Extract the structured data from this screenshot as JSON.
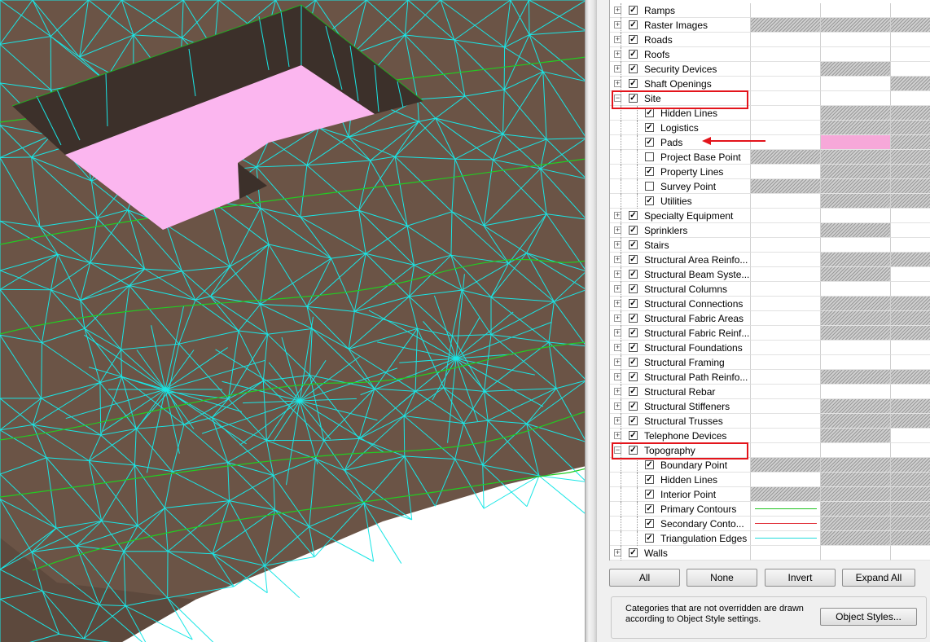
{
  "viewport": {
    "description_icons": [
      "terrain-mesh"
    ],
    "colors": {
      "terrain": "#6b5446",
      "triangulation": "#19e6e6",
      "primary_contour": "#22cc22",
      "pad": "#fbb6ef",
      "pit_wall": "#3c302a"
    }
  },
  "tree": {
    "rows": [
      {
        "label": "Ramps",
        "level": 0,
        "checked": true,
        "expander": "+",
        "c1": "",
        "c2": "",
        "c3": ""
      },
      {
        "label": "Raster Images",
        "level": 0,
        "checked": true,
        "expander": "+",
        "c1": "hatch",
        "c2": "hatch",
        "c3": "hatch"
      },
      {
        "label": "Roads",
        "level": 0,
        "checked": true,
        "expander": "+",
        "c1": "",
        "c2": "",
        "c3": ""
      },
      {
        "label": "Roofs",
        "level": 0,
        "checked": true,
        "expander": "+",
        "c1": "",
        "c2": "",
        "c3": ""
      },
      {
        "label": "Security Devices",
        "level": 0,
        "checked": true,
        "expander": "+",
        "c1": "",
        "c2": "hatch",
        "c3": ""
      },
      {
        "label": "Shaft Openings",
        "level": 0,
        "checked": true,
        "expander": "+",
        "c1": "",
        "c2": "",
        "c3": "hatch"
      },
      {
        "label": "Site",
        "level": 0,
        "checked": true,
        "expander": "-",
        "c1": "",
        "c2": "",
        "c3": ""
      },
      {
        "label": "Hidden Lines",
        "level": 1,
        "checked": true,
        "expander": "",
        "c1": "",
        "c2": "hatch",
        "c3": "hatch"
      },
      {
        "label": "Logistics",
        "level": 1,
        "checked": true,
        "expander": "",
        "c1": "",
        "c2": "hatch",
        "c3": "hatch"
      },
      {
        "label": "Pads",
        "level": 1,
        "checked": true,
        "expander": "",
        "c1": "",
        "c2": "pink",
        "c3": "hatch"
      },
      {
        "label": "Project Base Point",
        "level": 1,
        "checked": false,
        "expander": "",
        "c1": "hatch",
        "c2": "hatch",
        "c3": "hatch"
      },
      {
        "label": "Property Lines",
        "level": 1,
        "checked": true,
        "expander": "",
        "c1": "",
        "c2": "hatch",
        "c3": "hatch"
      },
      {
        "label": "Survey Point",
        "level": 1,
        "checked": false,
        "expander": "",
        "c1": "hatch",
        "c2": "hatch",
        "c3": "hatch"
      },
      {
        "label": "Utilities",
        "level": 1,
        "checked": true,
        "expander": "",
        "c1": "",
        "c2": "hatch",
        "c3": "hatch"
      },
      {
        "label": "Specialty Equipment",
        "level": 0,
        "checked": true,
        "expander": "+",
        "c1": "",
        "c2": "",
        "c3": ""
      },
      {
        "label": "Sprinklers",
        "level": 0,
        "checked": true,
        "expander": "+",
        "c1": "",
        "c2": "hatch",
        "c3": ""
      },
      {
        "label": "Stairs",
        "level": 0,
        "checked": true,
        "expander": "+",
        "c1": "",
        "c2": "",
        "c3": ""
      },
      {
        "label": "Structural Area Reinfo...",
        "level": 0,
        "checked": true,
        "expander": "+",
        "c1": "",
        "c2": "hatch",
        "c3": "hatch"
      },
      {
        "label": "Structural Beam Syste...",
        "level": 0,
        "checked": true,
        "expander": "+",
        "c1": "",
        "c2": "hatch",
        "c3": ""
      },
      {
        "label": "Structural Columns",
        "level": 0,
        "checked": true,
        "expander": "+",
        "c1": "",
        "c2": "",
        "c3": ""
      },
      {
        "label": "Structural Connections",
        "level": 0,
        "checked": true,
        "expander": "+",
        "c1": "",
        "c2": "hatch",
        "c3": "hatch"
      },
      {
        "label": "Structural Fabric Areas",
        "level": 0,
        "checked": true,
        "expander": "+",
        "c1": "",
        "c2": "hatch",
        "c3": "hatch"
      },
      {
        "label": "Structural Fabric Reinf...",
        "level": 0,
        "checked": true,
        "expander": "+",
        "c1": "",
        "c2": "hatch",
        "c3": "hatch"
      },
      {
        "label": "Structural Foundations",
        "level": 0,
        "checked": true,
        "expander": "+",
        "c1": "",
        "c2": "",
        "c3": ""
      },
      {
        "label": "Structural Framing",
        "level": 0,
        "checked": true,
        "expander": "+",
        "c1": "",
        "c2": "",
        "c3": ""
      },
      {
        "label": "Structural Path Reinfo...",
        "level": 0,
        "checked": true,
        "expander": "+",
        "c1": "",
        "c2": "hatch",
        "c3": "hatch"
      },
      {
        "label": "Structural Rebar",
        "level": 0,
        "checked": true,
        "expander": "+",
        "c1": "",
        "c2": "",
        "c3": ""
      },
      {
        "label": "Structural Stiffeners",
        "level": 0,
        "checked": true,
        "expander": "+",
        "c1": "",
        "c2": "hatch",
        "c3": "hatch"
      },
      {
        "label": "Structural Trusses",
        "level": 0,
        "checked": true,
        "expander": "+",
        "c1": "",
        "c2": "hatch",
        "c3": "hatch"
      },
      {
        "label": "Telephone Devices",
        "level": 0,
        "checked": true,
        "expander": "+",
        "c1": "",
        "c2": "hatch",
        "c3": ""
      },
      {
        "label": "Topography",
        "level": 0,
        "checked": true,
        "expander": "-",
        "c1": "",
        "c2": "",
        "c3": ""
      },
      {
        "label": "Boundary Point",
        "level": 1,
        "checked": true,
        "expander": "",
        "c1": "hatch",
        "c2": "hatch",
        "c3": "hatch"
      },
      {
        "label": "Hidden Lines",
        "level": 1,
        "checked": true,
        "expander": "",
        "c1": "",
        "c2": "hatch",
        "c3": "hatch"
      },
      {
        "label": "Interior Point",
        "level": 1,
        "checked": true,
        "expander": "",
        "c1": "hatch",
        "c2": "hatch",
        "c3": "hatch"
      },
      {
        "label": "Primary Contours",
        "level": 1,
        "checked": true,
        "expander": "",
        "c1": "line-green",
        "c2": "hatch",
        "c3": "hatch"
      },
      {
        "label": "Secondary Conto...",
        "level": 1,
        "checked": true,
        "expander": "",
        "c1": "line-red",
        "c2": "hatch",
        "c3": "hatch"
      },
      {
        "label": "Triangulation Edges",
        "level": 1,
        "checked": true,
        "expander": "",
        "c1": "line-cyan",
        "c2": "hatch",
        "c3": "hatch"
      },
      {
        "label": "Walls",
        "level": 0,
        "checked": true,
        "expander": "+",
        "c1": "",
        "c2": "",
        "c3": ""
      }
    ],
    "line_colors": {
      "line-green": "#22c322",
      "line-red": "#e0303a",
      "line-cyan": "#22dcdc"
    }
  },
  "buttons": {
    "all": "All",
    "none": "None",
    "invert": "Invert",
    "expand_all": "Expand All",
    "object_styles": "Object Styles..."
  },
  "note": "Categories that are not overridden are drawn according to Object Style settings."
}
